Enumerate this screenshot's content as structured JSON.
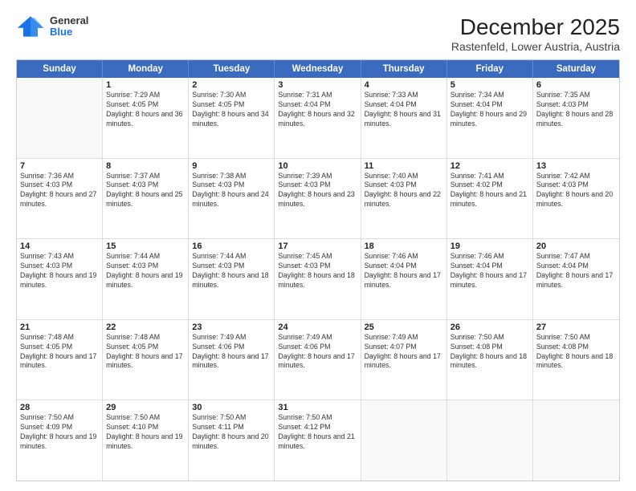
{
  "header": {
    "logo": {
      "general": "General",
      "blue": "Blue"
    },
    "title": "December 2025",
    "subtitle": "Rastenfeld, Lower Austria, Austria"
  },
  "weekdays": [
    "Sunday",
    "Monday",
    "Tuesday",
    "Wednesday",
    "Thursday",
    "Friday",
    "Saturday"
  ],
  "rows": [
    [
      {
        "day": "",
        "empty": true
      },
      {
        "day": "1",
        "sunrise": "Sunrise: 7:29 AM",
        "sunset": "Sunset: 4:05 PM",
        "daylight": "Daylight: 8 hours and 36 minutes."
      },
      {
        "day": "2",
        "sunrise": "Sunrise: 7:30 AM",
        "sunset": "Sunset: 4:05 PM",
        "daylight": "Daylight: 8 hours and 34 minutes."
      },
      {
        "day": "3",
        "sunrise": "Sunrise: 7:31 AM",
        "sunset": "Sunset: 4:04 PM",
        "daylight": "Daylight: 8 hours and 32 minutes."
      },
      {
        "day": "4",
        "sunrise": "Sunrise: 7:33 AM",
        "sunset": "Sunset: 4:04 PM",
        "daylight": "Daylight: 8 hours and 31 minutes."
      },
      {
        "day": "5",
        "sunrise": "Sunrise: 7:34 AM",
        "sunset": "Sunset: 4:04 PM",
        "daylight": "Daylight: 8 hours and 29 minutes."
      },
      {
        "day": "6",
        "sunrise": "Sunrise: 7:35 AM",
        "sunset": "Sunset: 4:03 PM",
        "daylight": "Daylight: 8 hours and 28 minutes."
      }
    ],
    [
      {
        "day": "7",
        "sunrise": "Sunrise: 7:36 AM",
        "sunset": "Sunset: 4:03 PM",
        "daylight": "Daylight: 8 hours and 27 minutes."
      },
      {
        "day": "8",
        "sunrise": "Sunrise: 7:37 AM",
        "sunset": "Sunset: 4:03 PM",
        "daylight": "Daylight: 8 hours and 25 minutes."
      },
      {
        "day": "9",
        "sunrise": "Sunrise: 7:38 AM",
        "sunset": "Sunset: 4:03 PM",
        "daylight": "Daylight: 8 hours and 24 minutes."
      },
      {
        "day": "10",
        "sunrise": "Sunrise: 7:39 AM",
        "sunset": "Sunset: 4:03 PM",
        "daylight": "Daylight: 8 hours and 23 minutes."
      },
      {
        "day": "11",
        "sunrise": "Sunrise: 7:40 AM",
        "sunset": "Sunset: 4:03 PM",
        "daylight": "Daylight: 8 hours and 22 minutes."
      },
      {
        "day": "12",
        "sunrise": "Sunrise: 7:41 AM",
        "sunset": "Sunset: 4:02 PM",
        "daylight": "Daylight: 8 hours and 21 minutes."
      },
      {
        "day": "13",
        "sunrise": "Sunrise: 7:42 AM",
        "sunset": "Sunset: 4:03 PM",
        "daylight": "Daylight: 8 hours and 20 minutes."
      }
    ],
    [
      {
        "day": "14",
        "sunrise": "Sunrise: 7:43 AM",
        "sunset": "Sunset: 4:03 PM",
        "daylight": "Daylight: 8 hours and 19 minutes."
      },
      {
        "day": "15",
        "sunrise": "Sunrise: 7:44 AM",
        "sunset": "Sunset: 4:03 PM",
        "daylight": "Daylight: 8 hours and 19 minutes."
      },
      {
        "day": "16",
        "sunrise": "Sunrise: 7:44 AM",
        "sunset": "Sunset: 4:03 PM",
        "daylight": "Daylight: 8 hours and 18 minutes."
      },
      {
        "day": "17",
        "sunrise": "Sunrise: 7:45 AM",
        "sunset": "Sunset: 4:03 PM",
        "daylight": "Daylight: 8 hours and 18 minutes."
      },
      {
        "day": "18",
        "sunrise": "Sunrise: 7:46 AM",
        "sunset": "Sunset: 4:04 PM",
        "daylight": "Daylight: 8 hours and 17 minutes."
      },
      {
        "day": "19",
        "sunrise": "Sunrise: 7:46 AM",
        "sunset": "Sunset: 4:04 PM",
        "daylight": "Daylight: 8 hours and 17 minutes."
      },
      {
        "day": "20",
        "sunrise": "Sunrise: 7:47 AM",
        "sunset": "Sunset: 4:04 PM",
        "daylight": "Daylight: 8 hours and 17 minutes."
      }
    ],
    [
      {
        "day": "21",
        "sunrise": "Sunrise: 7:48 AM",
        "sunset": "Sunset: 4:05 PM",
        "daylight": "Daylight: 8 hours and 17 minutes."
      },
      {
        "day": "22",
        "sunrise": "Sunrise: 7:48 AM",
        "sunset": "Sunset: 4:05 PM",
        "daylight": "Daylight: 8 hours and 17 minutes."
      },
      {
        "day": "23",
        "sunrise": "Sunrise: 7:49 AM",
        "sunset": "Sunset: 4:06 PM",
        "daylight": "Daylight: 8 hours and 17 minutes."
      },
      {
        "day": "24",
        "sunrise": "Sunrise: 7:49 AM",
        "sunset": "Sunset: 4:06 PM",
        "daylight": "Daylight: 8 hours and 17 minutes."
      },
      {
        "day": "25",
        "sunrise": "Sunrise: 7:49 AM",
        "sunset": "Sunset: 4:07 PM",
        "daylight": "Daylight: 8 hours and 17 minutes."
      },
      {
        "day": "26",
        "sunrise": "Sunrise: 7:50 AM",
        "sunset": "Sunset: 4:08 PM",
        "daylight": "Daylight: 8 hours and 18 minutes."
      },
      {
        "day": "27",
        "sunrise": "Sunrise: 7:50 AM",
        "sunset": "Sunset: 4:08 PM",
        "daylight": "Daylight: 8 hours and 18 minutes."
      }
    ],
    [
      {
        "day": "28",
        "sunrise": "Sunrise: 7:50 AM",
        "sunset": "Sunset: 4:09 PM",
        "daylight": "Daylight: 8 hours and 19 minutes."
      },
      {
        "day": "29",
        "sunrise": "Sunrise: 7:50 AM",
        "sunset": "Sunset: 4:10 PM",
        "daylight": "Daylight: 8 hours and 19 minutes."
      },
      {
        "day": "30",
        "sunrise": "Sunrise: 7:50 AM",
        "sunset": "Sunset: 4:11 PM",
        "daylight": "Daylight: 8 hours and 20 minutes."
      },
      {
        "day": "31",
        "sunrise": "Sunrise: 7:50 AM",
        "sunset": "Sunset: 4:12 PM",
        "daylight": "Daylight: 8 hours and 21 minutes."
      },
      {
        "day": "",
        "empty": true
      },
      {
        "day": "",
        "empty": true
      },
      {
        "day": "",
        "empty": true
      }
    ]
  ]
}
